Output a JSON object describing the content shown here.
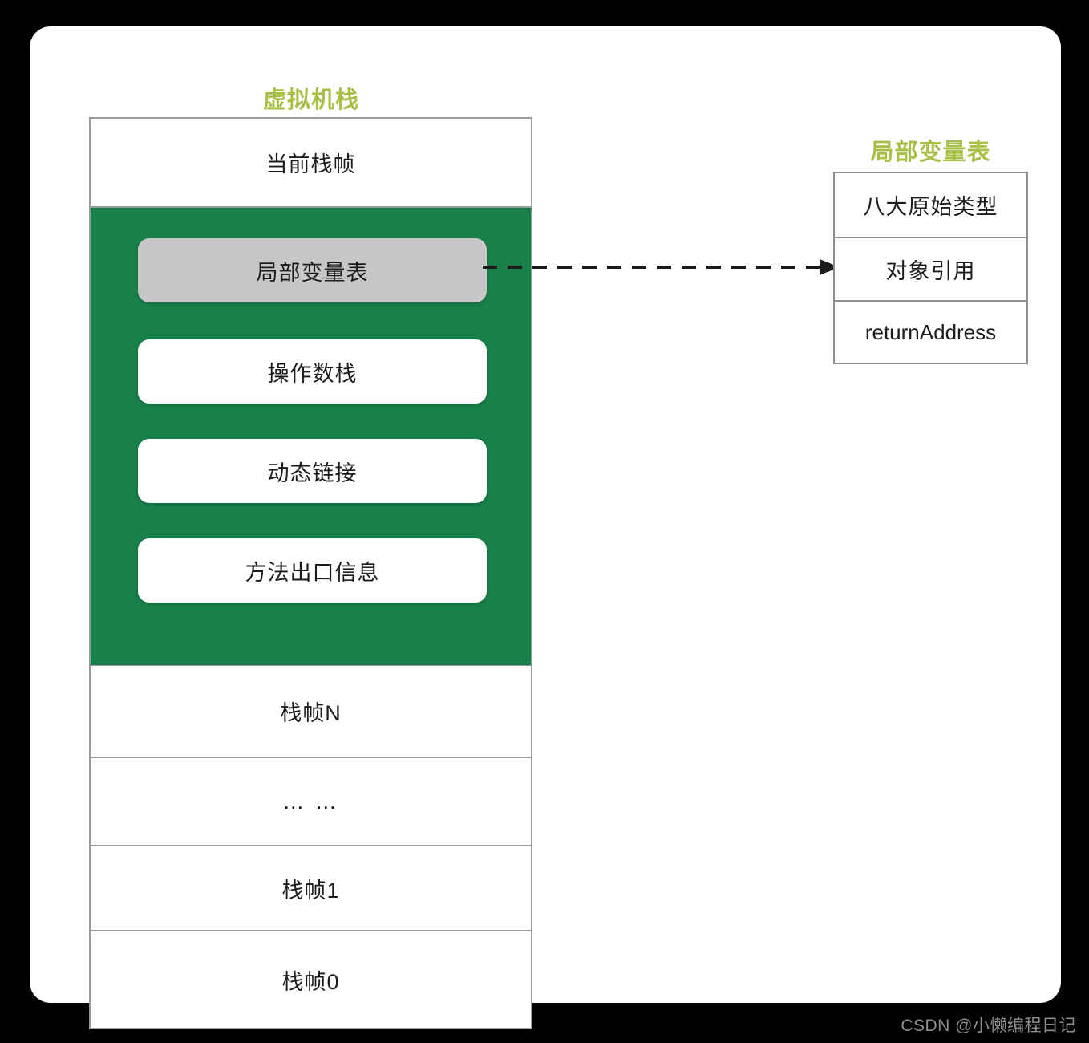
{
  "diagram": {
    "vm_stack": {
      "title": "虚拟机栈",
      "title_color": "#a9c048",
      "rows": [
        {
          "label": "当前栈帧"
        },
        {
          "label": "栈帧N"
        },
        {
          "label": "… …"
        },
        {
          "label": "栈帧1"
        },
        {
          "label": "栈帧0"
        }
      ],
      "current_frame_detail": {
        "background_color": "#18814a",
        "items": [
          {
            "label": "局部变量表",
            "style": "gray",
            "fill": "#c7c7c7"
          },
          {
            "label": "操作数栈",
            "style": "white",
            "fill": "#ffffff"
          },
          {
            "label": "动态链接",
            "style": "white",
            "fill": "#ffffff"
          },
          {
            "label": "方法出口信息",
            "style": "white",
            "fill": "#ffffff"
          }
        ]
      }
    },
    "local_variable_table": {
      "title": "局部变量表",
      "title_color": "#a9c048",
      "rows": [
        {
          "label": "八大原始类型"
        },
        {
          "label": "对象引用"
        },
        {
          "label": "returnAddress"
        }
      ]
    },
    "connector": {
      "kind": "dashed-arrow",
      "direction": "right",
      "color": "#1c1c1c"
    }
  },
  "watermark": {
    "text": "CSDN @小懒编程日记",
    "color": "#8f8f8f"
  }
}
